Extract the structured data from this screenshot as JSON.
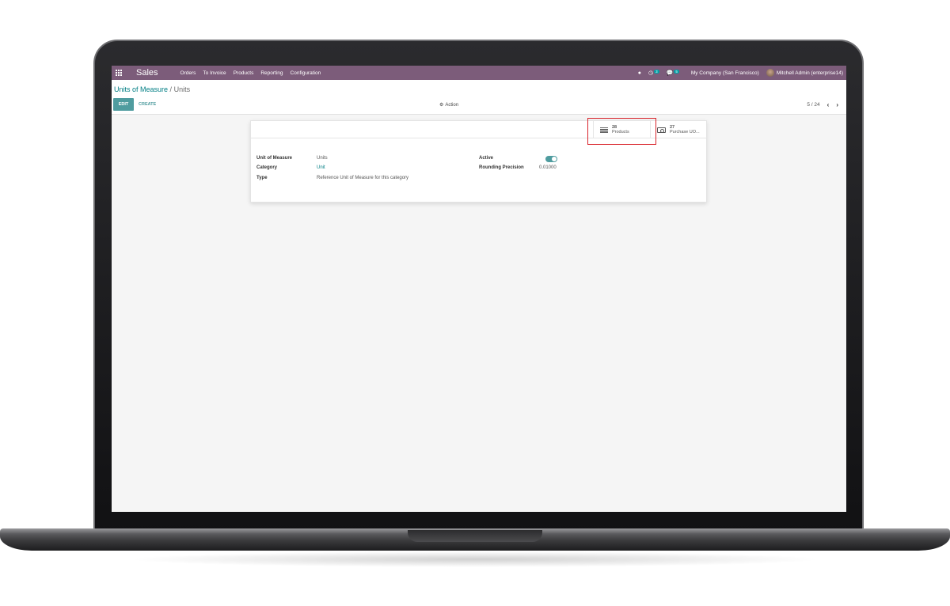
{
  "navbar": {
    "app_name": "Sales",
    "menu": [
      "Orders",
      "To Invoice",
      "Products",
      "Reporting",
      "Configuration"
    ],
    "activity_badge": "3",
    "messages_badge": "5",
    "company": "My Company (San Francisco)",
    "user": "Mitchell Admin (enterprise14)"
  },
  "breadcrumb": {
    "parent": "Units of Measure",
    "separator": "/",
    "current": "Units"
  },
  "toolbar": {
    "edit_label": "EDIT",
    "create_label": "CREATE",
    "action_label": "Action",
    "pager": "5 / 24"
  },
  "stat_buttons": {
    "products": {
      "count": "28",
      "label": "Products"
    },
    "purchase": {
      "count": "27",
      "label": "Purchase UO..."
    }
  },
  "form": {
    "uom_label": "Unit of Measure",
    "uom_value": "Units",
    "category_label": "Category",
    "category_value": "Unit",
    "type_label": "Type",
    "type_value": "Reference Unit of Measure for this category",
    "active_label": "Active",
    "active_value": true,
    "rounding_label": "Rounding Precision",
    "rounding_value": "0.01000"
  },
  "colors": {
    "navbar": "#7c5c7a",
    "primary": "#4f9c9f",
    "link": "#017e84",
    "highlight_box": "#d9242b"
  }
}
